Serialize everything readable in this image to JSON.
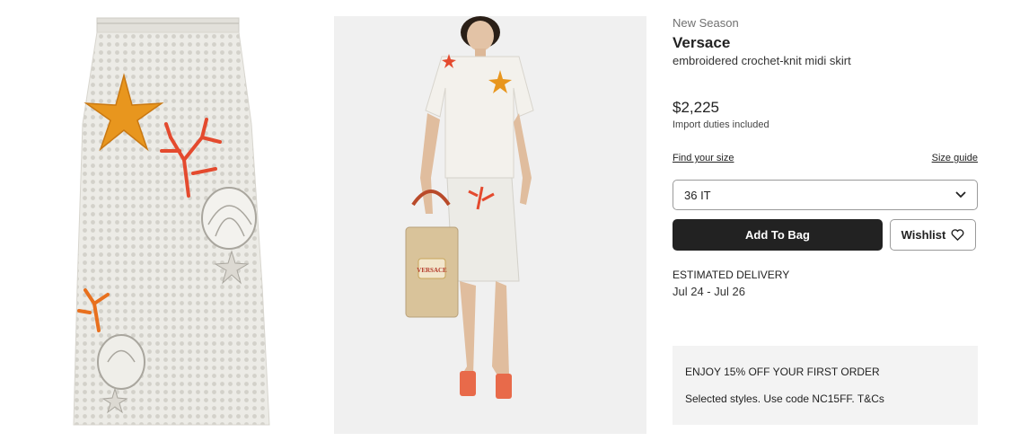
{
  "product": {
    "season": "New Season",
    "brand": "Versace",
    "name": "embroidered crochet-knit midi skirt",
    "price": "$2,225",
    "duties_note": "Import duties included"
  },
  "sizing": {
    "find_size_label": "Find your size",
    "size_guide_label": "Size guide",
    "selected_size": "36 IT"
  },
  "actions": {
    "add_to_bag_label": "Add To Bag",
    "wishlist_label": "Wishlist"
  },
  "delivery": {
    "title": "ESTIMATED DELIVERY",
    "dates": "Jul 24 - Jul 26"
  },
  "promo": {
    "title": "ENJOY 15% OFF YOUR FIRST ORDER",
    "text": "Selected styles. Use code NC15FF. T&Cs"
  },
  "colors": {
    "button_dark": "#222222",
    "promo_bg": "#f3f3f3",
    "skirt_knit": "#ecebe6",
    "starfish_orange": "#e8961e",
    "coral_red": "#e44a2e"
  }
}
